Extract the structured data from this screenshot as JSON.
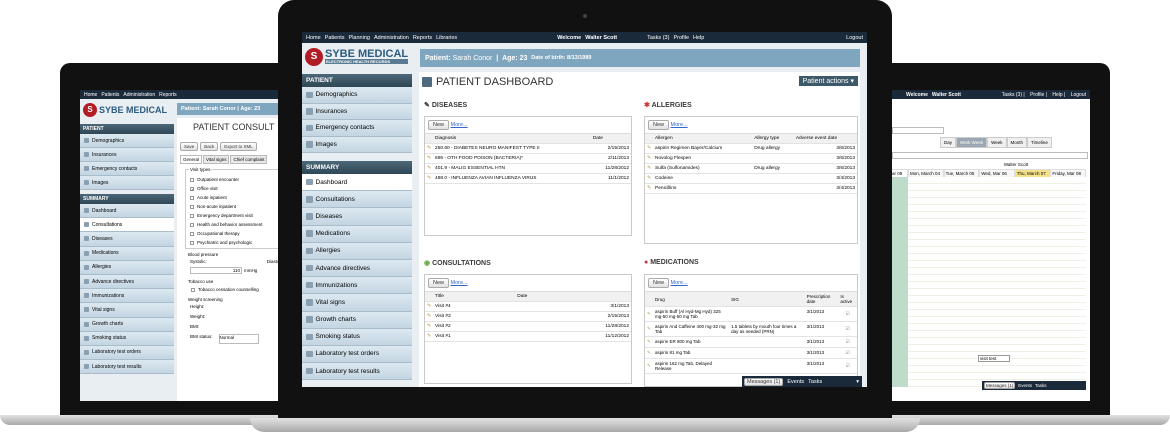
{
  "nav": {
    "home": "Home",
    "patients": "Patients",
    "planning": "Planning",
    "administration": "Administration",
    "reports": "Reports",
    "libraries": "Libraries",
    "welcome": "Welcome",
    "user": "Walter Scott",
    "tasks": "Tasks (3)",
    "profile": "Profile",
    "help": "Help",
    "logout": "Logout"
  },
  "logo": {
    "mark": "S",
    "name": "SYBE MEDICAL",
    "sub": "ELECTRONIC HEALTH RECORDS"
  },
  "patient": {
    "name_label": "Patient:",
    "name": "Sarah Conor",
    "age": "Age: 23",
    "dob": "Date of birth: 8/13/1989"
  },
  "sidebar": {
    "patient_header": "PATIENT",
    "patient_items": [
      "Demographics",
      "Insurances",
      "Emergency contacts",
      "Images"
    ],
    "summary_header": "SUMMARY",
    "summary_items": [
      "Dashboard",
      "Consultations",
      "Diseases",
      "Medications",
      "Allergies",
      "Advance directives",
      "Immunizations",
      "Vital signs",
      "Growth charts",
      "Smoking status",
      "Laboratory test orders",
      "Laboratory test results"
    ]
  },
  "dashboard": {
    "title": "PATIENT DASHBOARD",
    "actions": "Patient actions",
    "new": "New",
    "more": "More...",
    "diseases": {
      "title": "DISEASES",
      "cols": [
        "Diagnosis",
        "Date"
      ],
      "rows": [
        [
          "250.60 - DIABETES NEURO MANIFEST TYPE II",
          "2/15/2013"
        ],
        [
          "695 - OTH FOOD POISON (BACTERIA)*",
          "2/11/2013"
        ],
        [
          "401.9 - MALIG ESSENTIAL HTN",
          "11/28/2012"
        ],
        [
          "488.0 - INFLUENZA AVIAN INFLUENZA VIRUS",
          "11/1/2012"
        ]
      ]
    },
    "allergies": {
      "title": "ALLERGIES",
      "cols": [
        "Allergen",
        "Allergy type",
        "Adverse event date"
      ],
      "rows": [
        [
          "aspirin Regimen Bayer/Calcium",
          "Drug allergy",
          "3/6/2013"
        ],
        [
          "Novolog Flexpen",
          "",
          "3/6/2013"
        ],
        [
          "Sulfa (Sulfonamides)",
          "Drug allergy",
          "3/6/2013"
        ],
        [
          "Codeine",
          "",
          "3/4/2013"
        ],
        [
          "Penicillins",
          "",
          "3/4/2013"
        ]
      ]
    },
    "consultations": {
      "title": "CONSULTATIONS",
      "cols": [
        "Title",
        "Date"
      ],
      "rows": [
        [
          "Visit #4",
          "3/1/2013"
        ],
        [
          "Visit #3",
          "2/15/2013"
        ],
        [
          "Visit #2",
          "11/28/2012"
        ],
        [
          "Visit #1",
          "11/12/2012"
        ]
      ]
    },
    "medications": {
      "title": "MEDICATIONS",
      "cols": [
        "Drug",
        "SIG",
        "Prescription date",
        "Is active"
      ],
      "rows": [
        [
          "aspirin Buff (Al Hyd-Mg Hyd) 325 mg-50 mg-50 mg Tab",
          "",
          "3/1/2013"
        ],
        [
          "aspirin And Caffeine 400 mg-32 mg Tab",
          "1.5 tablets by mouth four times a day as needed (PRN)",
          "3/1/2013"
        ],
        [
          "aspirin ER 800 mg Tab",
          "",
          "3/1/2013"
        ],
        [
          "aspirin 81 mg Tab",
          "",
          "3/1/2013"
        ],
        [
          "aspirin 162 mg Tab, Delayed Release",
          "",
          "3/1/2013"
        ]
      ]
    }
  },
  "messages": {
    "messages": "Messages (1)",
    "events": "Events",
    "tasks": "Tasks"
  },
  "consult": {
    "title": "PATIENT CONSULT",
    "save": "Save",
    "back": "Back",
    "export": "Export to XML",
    "tabs": [
      "General",
      "Vital signs",
      "Chief complaint"
    ],
    "visit_types_label": "Visit types",
    "visit_types": [
      "Outpatient encounter",
      "Office visit",
      "Acute inpatient",
      "Non-acute inpatient",
      "Emergency department visit",
      "Health and behavior assessment",
      "Occupational therapy",
      "Psychiatric and psychologic"
    ],
    "bp_label": "Blood pressure",
    "systolic": "Systolic:",
    "diastolic": "Diastolic:",
    "systolic_value": "110",
    "mmhg": "mmHg",
    "tobacco_label": "Tobacco use",
    "tobacco_item": "Tobacco cessation counselling",
    "weight_label": "Weight screening",
    "height": "Height:",
    "height_value": "150.00",
    "weight": "Weight:",
    "weight_value": "55.00",
    "bmi": "BMI:",
    "bmi_value": "24.93",
    "bmi_status": "BMI status:",
    "bmi_status_value": "Normal",
    "age": "Age: 23"
  },
  "calendar": {
    "views": [
      "Day",
      "Work Week",
      "Week",
      "Month",
      "Timeline"
    ],
    "person": "Walter Scott",
    "days": [
      "Mon, March 04",
      "Tue, March 05",
      "Wed, Mar 06",
      "Thu, March 07",
      "Friday, Mar 08"
    ],
    "prev": "ar 09",
    "event": "visit test"
  },
  "colors": {
    "nav": "#1b2a3a",
    "sidebar_head": "#3d5868",
    "patient_bar": "#7fa6bf",
    "logo_red": "#b21d25",
    "accent_today": "#f5e18a"
  }
}
